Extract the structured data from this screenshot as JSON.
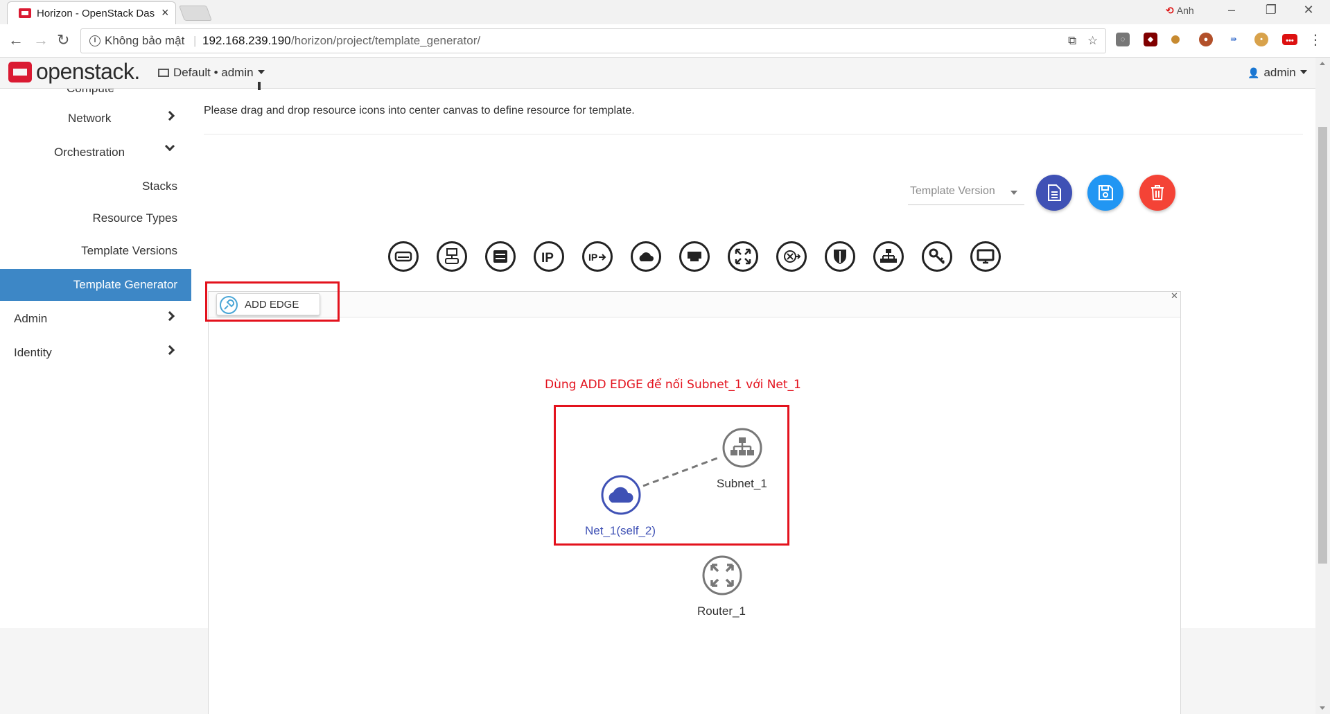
{
  "browser": {
    "tab_title": "Horizon - OpenStack Dashboard",
    "window_user": "Anh",
    "security_label": "Không bảo mật",
    "url_host": "192.168.239.190",
    "url_path": "/horizon/project/template_generator/"
  },
  "header": {
    "logo_text": "openstack.",
    "project_label": "Default • admin",
    "user_label": "admin"
  },
  "sidebar": {
    "partial_item": "Compute",
    "items": [
      {
        "label": "Network"
      },
      {
        "label": "Orchestration"
      },
      {
        "label": "Stacks"
      },
      {
        "label": "Resource Types"
      },
      {
        "label": "Template Versions"
      },
      {
        "label": "Template Generator"
      },
      {
        "label": "Admin"
      },
      {
        "label": "Identity"
      }
    ]
  },
  "main": {
    "instructions": "Please drag and drop resource icons into center canvas to define resource for template.",
    "version_placeholder": "Template Version",
    "add_edge_label": "ADD EDGE",
    "annotation": "Dùng ADD EDGE để nối Subnet_1 với Net_1",
    "palette_icons": [
      "volume-icon",
      "volume-attachment-icon",
      "server-icon",
      "floating-ip-icon",
      "floating-ip-association-icon",
      "network-icon",
      "port-icon",
      "router-icon",
      "router-interface-icon",
      "security-group-icon",
      "subnet-icon",
      "keypair-icon",
      "instance-icon"
    ]
  },
  "graph": {
    "nodes": [
      {
        "id": "net",
        "label": "Net_1(self_2)",
        "selected": true
      },
      {
        "id": "subnet",
        "label": "Subnet_1",
        "selected": false
      },
      {
        "id": "router",
        "label": "Router_1",
        "selected": false
      }
    ],
    "edges": [
      {
        "from": "net",
        "to": "subnet",
        "style": "dashed"
      }
    ]
  },
  "colors": {
    "accent_blue": "#3d87c6",
    "selected_node": "#3f51b5",
    "annotation_red": "#e3121d",
    "fab_indigo": "#3f51b5",
    "fab_blue": "#2196f3",
    "fab_red": "#f44336"
  }
}
